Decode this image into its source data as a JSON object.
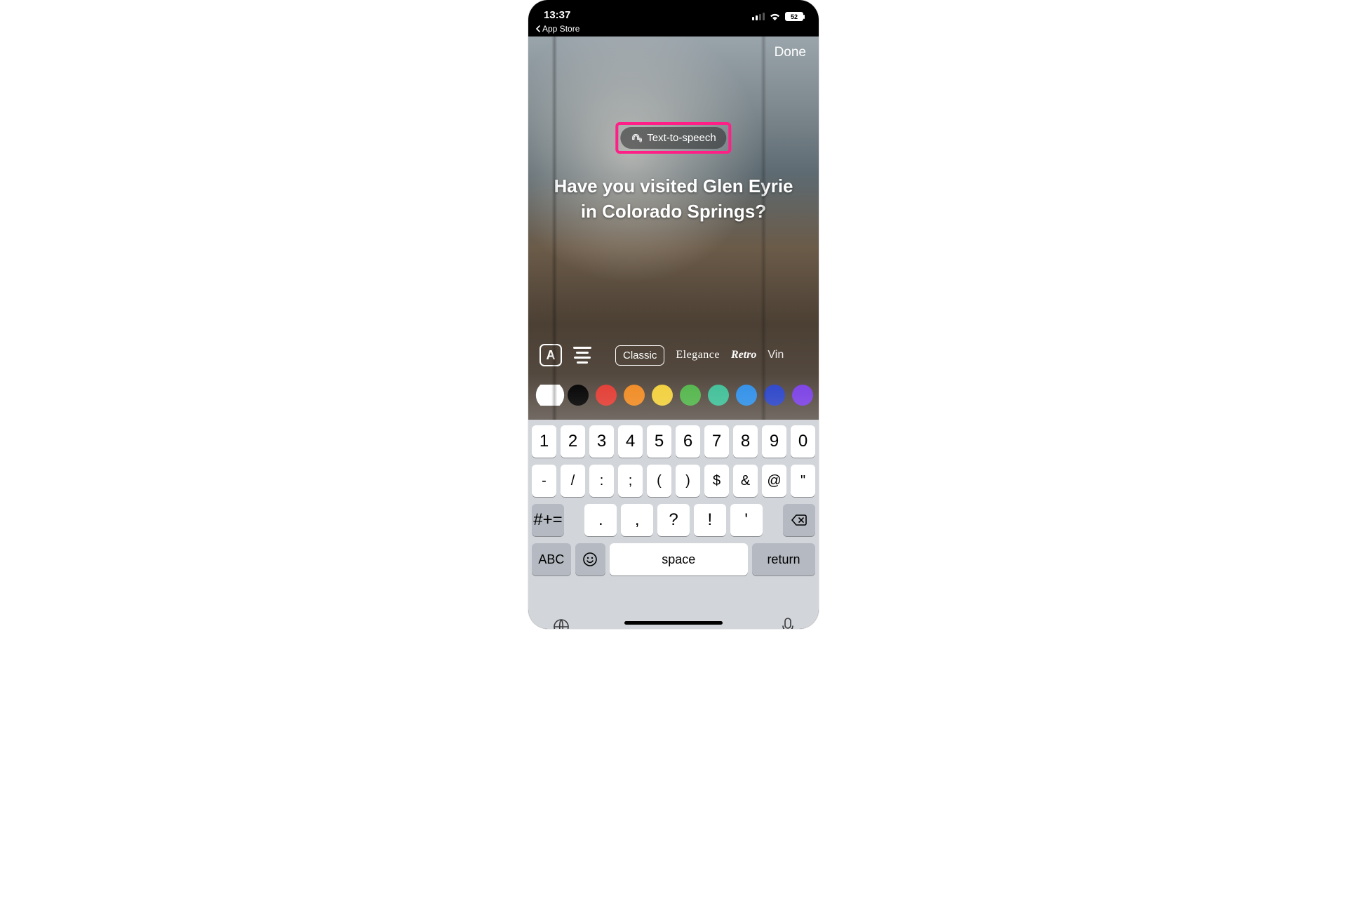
{
  "status": {
    "time": "13:37",
    "back_label": "App Store",
    "battery": "52"
  },
  "editor": {
    "done_label": "Done",
    "tts_label": "Text-to-speech",
    "overlay_text": "Have you visited Glen Eyrie in Colorado Springs?",
    "style_icon_letter": "A",
    "fonts": [
      "Classic",
      "Elegance",
      "Retro",
      "Vin"
    ],
    "colors": [
      "#ffffff",
      "#000000",
      "#e23b32",
      "#f08a22",
      "#f1cf3b",
      "#52b54a",
      "#3fbf97",
      "#2f8fe8",
      "#2b44c8",
      "#7b3fe4"
    ]
  },
  "keyboard": {
    "row1": [
      "1",
      "2",
      "3",
      "4",
      "5",
      "6",
      "7",
      "8",
      "9",
      "0"
    ],
    "row2": [
      "-",
      "/",
      ":",
      ";",
      "(",
      ")",
      "$",
      "&",
      "@",
      "\""
    ],
    "row3_shift": "#+=",
    "row3": [
      ".",
      ",",
      "?",
      "!",
      "'"
    ],
    "row4": {
      "abc": "ABC",
      "space": "space",
      "return": "return"
    }
  }
}
